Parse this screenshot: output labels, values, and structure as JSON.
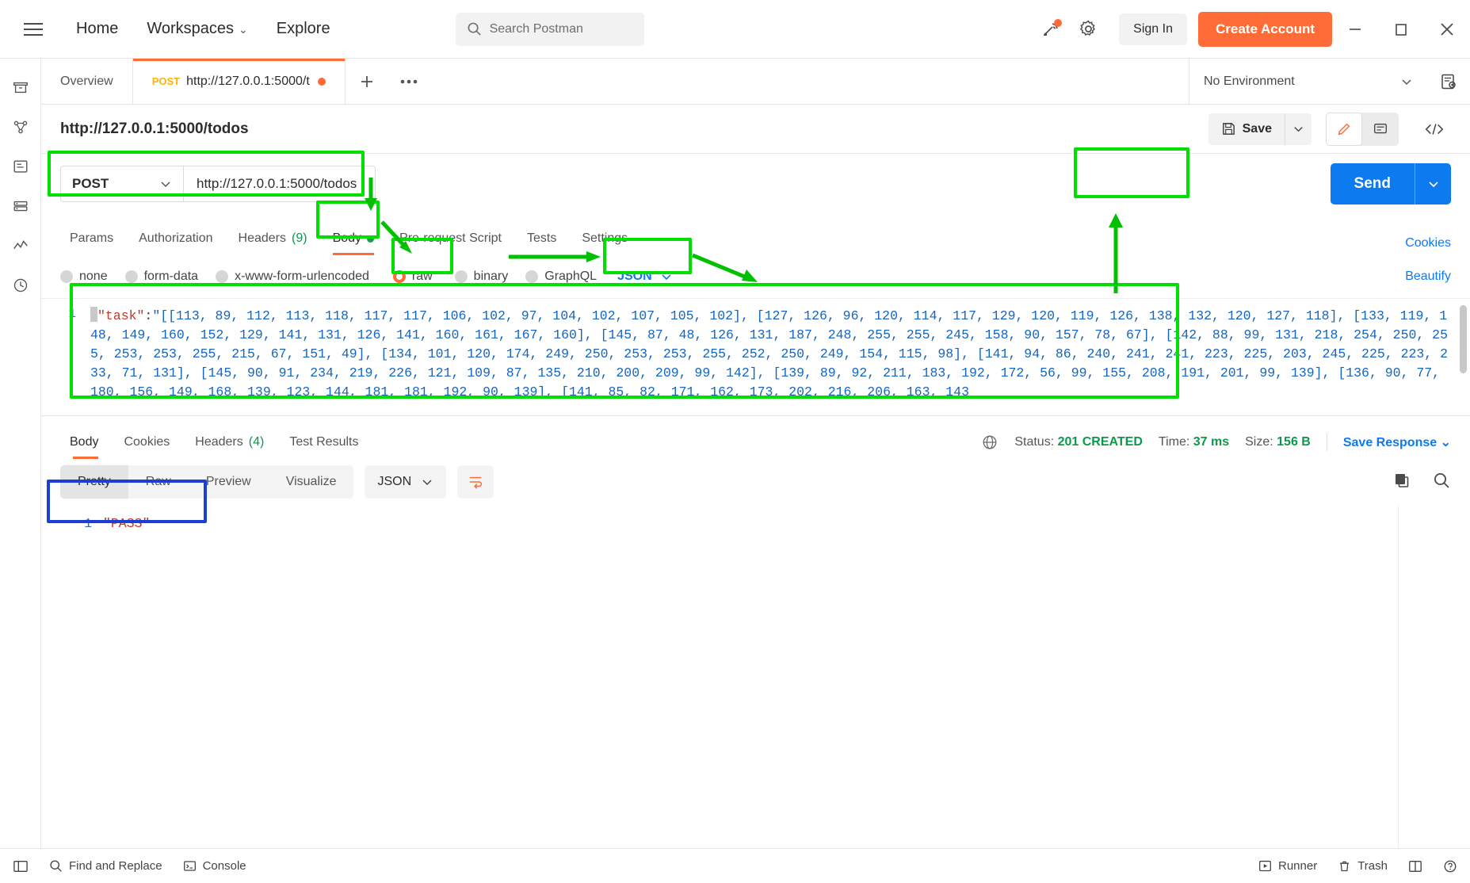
{
  "header": {
    "menu_icon": "hamburger-icon",
    "nav": [
      {
        "label": "Home"
      },
      {
        "label": "Workspaces",
        "caret": "⌄"
      },
      {
        "label": "Explore"
      }
    ],
    "search_placeholder": "Search Postman",
    "search_icon": "search-icon",
    "invite_icon": "invite-icon",
    "settings_icon": "gear-icon",
    "signin_label": "Sign In",
    "create_account_label": "Create Account",
    "window_minimize": "—",
    "window_maximize": "□",
    "window_close": "✕",
    "accent_color": "#ff6c37"
  },
  "left_rail": {
    "items": [
      {
        "icon": "collections-icon"
      },
      {
        "icon": "apis-icon"
      },
      {
        "icon": "environments-icon"
      },
      {
        "icon": "mock-servers-icon"
      },
      {
        "icon": "monitors-icon"
      },
      {
        "icon": "history-icon"
      }
    ]
  },
  "tab_bar": {
    "tabs": [
      {
        "label": "Overview",
        "active": false
      },
      {
        "method": "POST",
        "label": "http://127.0.0.1:5000/t",
        "active": true,
        "unsaved": true
      }
    ],
    "add_label": "+",
    "more_label": "●●●",
    "environment": "No Environment",
    "environment_caret": "⌄",
    "env_eye_icon": "environment-quick-look-icon"
  },
  "request_title": {
    "title": "http://127.0.0.1:5000/todos",
    "save_label": "Save",
    "save_icon": "save-disk-icon",
    "save_caret": "⌄",
    "edit_icon": "pencil-icon",
    "comment_icon": "comment-icon",
    "code_icon": "code-snippet-icon"
  },
  "url_bar": {
    "method": "POST",
    "method_caret": "⌄",
    "url": "http://127.0.0.1:5000/todos",
    "send_label": "Send",
    "send_caret": "⌄",
    "send_color": "#0e7af0"
  },
  "request_tabs": {
    "tabs": [
      {
        "label": "Params"
      },
      {
        "label": "Authorization"
      },
      {
        "label": "Headers",
        "count": "(9)"
      },
      {
        "label": "Body",
        "active": true,
        "dot": true
      },
      {
        "label": "Pre-request Script"
      },
      {
        "label": "Tests"
      },
      {
        "label": "Settings"
      }
    ],
    "cookies_link": "Cookies",
    "beautify_link": "Beautify"
  },
  "body_types": {
    "options": [
      {
        "label": "none",
        "selected": false
      },
      {
        "label": "form-data",
        "selected": false
      },
      {
        "label": "x-www-form-urlencoded",
        "selected": false
      },
      {
        "label": "raw",
        "selected": true
      },
      {
        "label": "binary",
        "selected": false
      },
      {
        "label": "GraphQL",
        "selected": false
      }
    ],
    "format": "JSON",
    "format_caret": "⌄"
  },
  "request_body": {
    "line_number": "1",
    "open_brace": "{",
    "key": "\"task\"",
    "colon": ":",
    "value_prefix": "\"[[113, 89, 112, 113, 118, 117, 117, 106, 102, 97, 104, 102, 107, 105, 102], [127, 126, 96, 120, 114, 117, 129, 120, 119, 126, 138, 132, 120, 127, 118], [133, 119, 148, 149, 160, 152, 129, 141, 131, 126, 141, 160, 161, 167, 160], [145, 87, 48, 126, 131, 187, 248, 255, 255, 245, 158, 90, 157, 78, 67], [142, 88, 99, 131, 218, 254, 250, 255, 253, 253, 255, 215, 67, 151, 49], [134, 101, 120, 174, 249, 250, 253, 253, 255, 252, 250, 249, 154, 115, 98], [141, 94, 86, 240, 241, 241, 223, 225, 203, 245, 225, 223, 233, 71, 131], [145, 90, 91, 234, 219, 226, 121, 109, 87, 135, 210, 200, 209, 99, 142], [139, 89, 92, 211, 183, 192, 172, 56, 99, 155, 208, 191, 201, 99, 139], [136, 90, 77, 180, 156, 149, 168, 139, 123, 144, 181, 181, 192, 90, 139], [141, 85, 82, 171, 162, 173, 202, 216, 206, 163, 143"
  },
  "response_tabs": {
    "tabs": [
      {
        "label": "Body",
        "active": true
      },
      {
        "label": "Cookies"
      },
      {
        "label": "Headers",
        "count": "(4)"
      },
      {
        "label": "Test Results"
      }
    ],
    "globe_icon": "globe-icon",
    "status_label": "Status:",
    "status_value": "201 CREATED",
    "time_label": "Time:",
    "time_value": "37 ms",
    "size_label": "Size:",
    "size_value": "156 B",
    "save_response_label": "Save Response",
    "save_response_caret": "⌄"
  },
  "response_view": {
    "pills": [
      {
        "label": "Pretty",
        "active": true
      },
      {
        "label": "Raw"
      },
      {
        "label": "Preview"
      },
      {
        "label": "Visualize"
      }
    ],
    "format": "JSON",
    "format_caret": "⌄",
    "wrap_icon": "wrap-lines-icon",
    "copy_icon": "copy-icon",
    "search_icon": "search-icon"
  },
  "response_body": {
    "line_number": "1",
    "value": "\"PASS\""
  },
  "footer": {
    "sidebar_icon": "toggle-sidebar-icon",
    "find_replace_label": "Find and Replace",
    "find_icon": "search-icon",
    "console_label": "Console",
    "console_icon": "terminal-icon",
    "runner_label": "Runner",
    "runner_icon": "runner-icon",
    "trash_label": "Trash",
    "trash_icon": "trash-icon",
    "layout_icon": "two-pane-icon",
    "help_icon": "help-icon"
  },
  "annotations": {
    "highlight_color": "#00e000",
    "response_highlight_color": "#1a3fd4",
    "boxes": [
      {
        "name": "method-url-highlight"
      },
      {
        "name": "body-tab-highlight"
      },
      {
        "name": "raw-radio-highlight"
      },
      {
        "name": "json-format-highlight"
      },
      {
        "name": "send-button-highlight"
      },
      {
        "name": "request-body-highlight"
      },
      {
        "name": "response-body-highlight"
      }
    ]
  }
}
